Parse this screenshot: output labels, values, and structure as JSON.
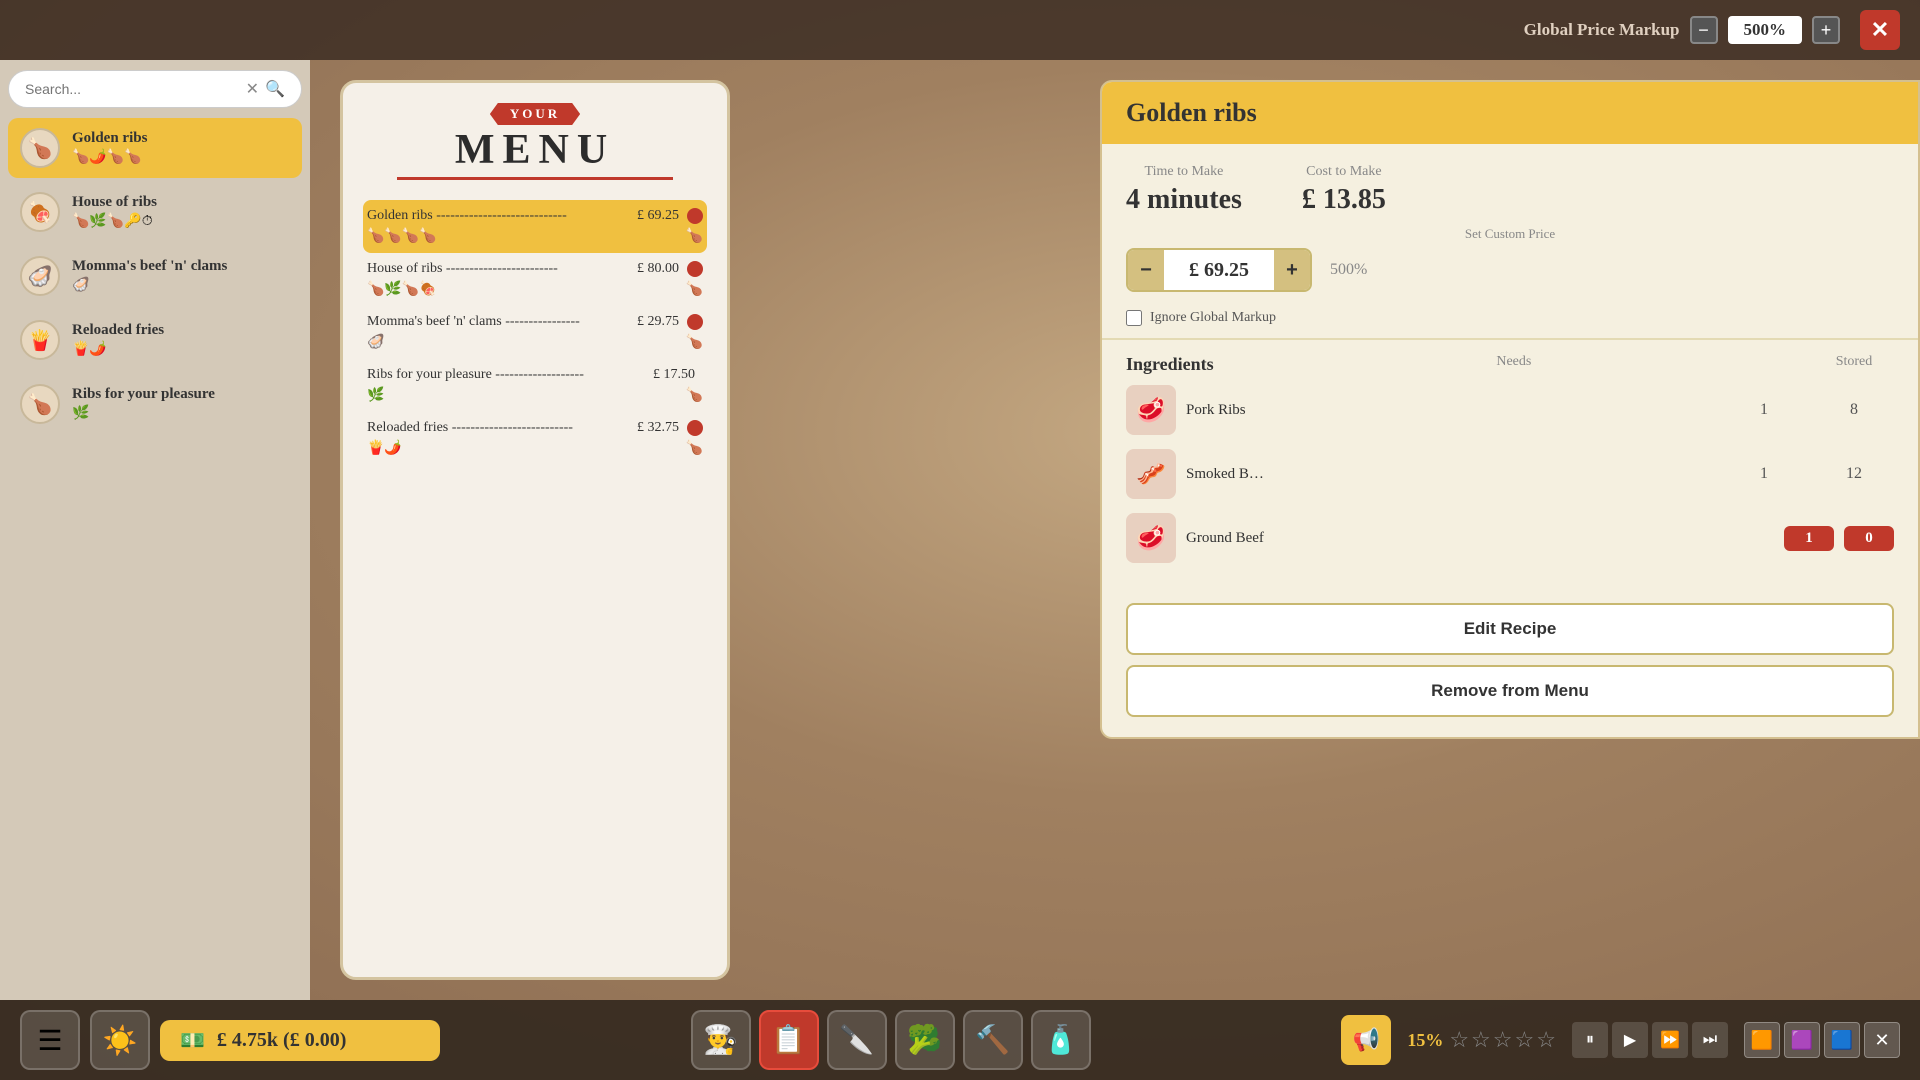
{
  "topBar": {
    "globalPriceMarkup": {
      "label": "Global Price Markup",
      "value": "500%",
      "decreaseLabel": "−",
      "increaseLabel": "+"
    },
    "closeLabel": "✕"
  },
  "sidebar": {
    "search": {
      "placeholder": "Search...",
      "clearIcon": "✕",
      "searchIcon": "🔍"
    },
    "items": [
      {
        "name": "Golden ribs",
        "icons": "🍗🌶️🍗🍗",
        "active": true
      },
      {
        "name": "House of ribs",
        "icons": "🍗🌿🍗🔑⏱",
        "active": false
      },
      {
        "name": "Momma's beef 'n' clams",
        "icons": "🦪",
        "active": false
      },
      {
        "name": "Reloaded fries",
        "icons": "🍟🌶️",
        "active": false
      },
      {
        "name": "Ribs for your pleasure",
        "icons": "🌿",
        "active": false
      }
    ]
  },
  "menuPanel": {
    "yourBanner": "YOUR",
    "menuText": "MENU",
    "items": [
      {
        "name": "Golden ribs",
        "dots": "----------------------------",
        "price": "£ 69.25",
        "hasRemove": true,
        "icons": "🍗🍗🍗🍗",
        "foodIcon": "🍗",
        "selected": true
      },
      {
        "name": "House of ribs",
        "dots": "------------------------",
        "price": "£ 80.00",
        "hasRemove": true,
        "icons": "🍗🌿🍗🍖",
        "foodIcon": "🍗",
        "selected": false
      },
      {
        "name": "Momma's beef 'n' clams",
        "dots": "----------------",
        "price": "£ 29.75",
        "hasRemove": true,
        "icons": "🦪",
        "foodIcon": "🍗",
        "selected": false
      },
      {
        "name": "Ribs for your pleasure",
        "dots": "------------------",
        "price": "£ 17.50",
        "hasRemove": false,
        "icons": "🌿",
        "foodIcon": "🍗",
        "selected": false
      },
      {
        "name": "Reloaded fries",
        "dots": "--------------------------",
        "price": "£ 32.75",
        "hasRemove": true,
        "icons": "🍟🌶️",
        "foodIcon": "🍗",
        "selected": false
      }
    ]
  },
  "detailPanel": {
    "title": "Golden ribs",
    "timeToMakeLabel": "Time to Make",
    "timeToMakeValue": "4 minutes",
    "costToMakeLabel": "Cost to Make",
    "costToMakeValue": "£ 13.85",
    "setCustomPriceLabel": "Set Custom Price",
    "customPrice": "£ 69.25",
    "pricePercent": "500%",
    "decreaseLabel": "−",
    "increaseLabel": "+",
    "ignoreMarkupLabel": "Ignore Global Markup",
    "ingredientsTitle": "Ingredients",
    "needsLabel": "Needs",
    "storedLabel": "Stored",
    "ingredients": [
      {
        "name": "Pork Ribs",
        "icon": "🥩",
        "needs": "1",
        "stored": "8",
        "storedOk": true
      },
      {
        "name": "Smoked B…",
        "icon": "🥓",
        "needs": "1",
        "stored": "12",
        "storedOk": true
      },
      {
        "name": "Ground Beef",
        "icon": "🥩",
        "needs": "1",
        "stored": "0",
        "storedOk": false
      }
    ],
    "editRecipeLabel": "Edit Recipe",
    "removeFromMenuLabel": "Remove from Menu"
  },
  "bottomBar": {
    "money": "£ 4.75k (£ 0.00)",
    "moneyIcon": "💵",
    "navIcons": [
      "👨‍🍳",
      "📋",
      "🔪",
      "🥦",
      "🔨",
      "🧴"
    ],
    "notificationIcon": "📢",
    "rating": "15%",
    "stars": [
      "☆",
      "☆",
      "☆",
      "☆",
      "☆"
    ],
    "playback": [
      "⏸",
      "▶",
      "⏩",
      "⏭"
    ],
    "settingsIcons": [
      "🟧",
      "🟪",
      "🟦",
      "✕"
    ]
  }
}
